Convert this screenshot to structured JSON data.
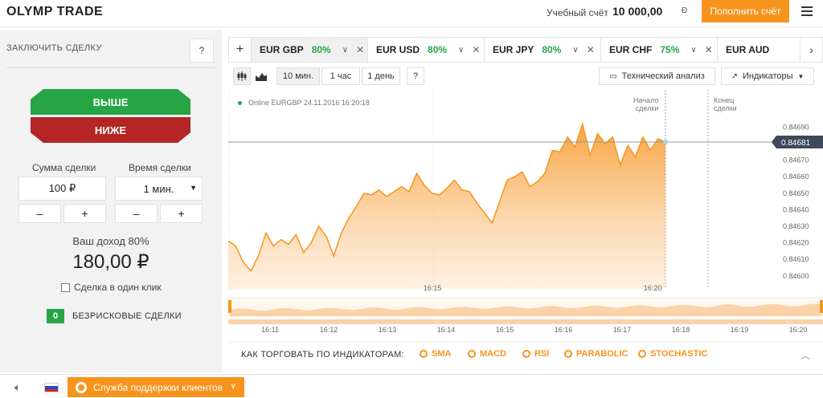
{
  "header": {
    "logo": "OLYMP TRADE",
    "account_label": "Учебный счёт",
    "account_value": "10 000,00",
    "account_currency": "Đ",
    "deposit_label": "Пополнить счёт"
  },
  "left": {
    "title": "ЗАКЛЮЧИТЬ СДЕЛКУ",
    "help": "?",
    "up_label": "ВЫШЕ",
    "down_label": "НИЖЕ",
    "amount_label": "Сумма сделки",
    "amount_value": "100 ₽",
    "time_label": "Время сделки",
    "time_value": "1 мин.",
    "minus": "–",
    "plus": "+",
    "profit_label": "Ваш доход 80%",
    "profit_value": "180,00 ₽",
    "oneclick_label": "Сделка в один клик",
    "riskfree_count": "0",
    "riskfree_label": "БЕЗРИСКОВЫЕ СДЕЛКИ"
  },
  "bottom": {
    "support_label": "Служба поддержки клиентов"
  },
  "tabs": [
    {
      "pair": "EUR GBP",
      "pct": "80%",
      "active": true
    },
    {
      "pair": "EUR USD",
      "pct": "80%",
      "active": false
    },
    {
      "pair": "EUR JPY",
      "pct": "80%",
      "active": false
    },
    {
      "pair": "EUR CHF",
      "pct": "75%",
      "active": false
    },
    {
      "pair": "EUR AUD",
      "pct": "",
      "active": false
    }
  ],
  "toolbar": {
    "tf_10m": "10 мин.",
    "tf_1h": "1 час",
    "tf_1d": "1 день",
    "help": "?",
    "tech_analysis": "Технический анализ",
    "indicators": "Индикаторы"
  },
  "chart": {
    "online_text": "Online EURGBP 24.11.2016 16:20:18",
    "start_label_1": "Начало",
    "start_label_2": "сделки",
    "end_label_1": "Конец",
    "end_label_2": "сделки",
    "current_price": "0.84681",
    "x_ticks": [
      "16:15",
      "16:20"
    ],
    "nav_ticks": [
      "16:11",
      "16:12",
      "16:13",
      "16:14",
      "16:15",
      "16:16",
      "16:17",
      "16:18",
      "16:19",
      "16:20"
    ],
    "accent": "#f7941d"
  },
  "chart_data": {
    "type": "area",
    "title": "",
    "xlabel": "",
    "ylabel": "",
    "ylim": [
      0.84596,
      0.84698
    ],
    "y_ticks": [
      0.8469,
      0.8468,
      0.8467,
      0.8466,
      0.8465,
      0.8464,
      0.8463,
      0.8462,
      0.8461,
      0.846
    ],
    "x_ticks": [
      "16:15",
      "16:20"
    ],
    "series": [
      {
        "values": [
          0.84621,
          0.84618,
          0.84608,
          0.84603,
          0.84612,
          0.84626,
          0.84618,
          0.84622,
          0.84619,
          0.84625,
          0.84614,
          0.8462,
          0.8463,
          0.84624,
          0.84612,
          0.84626,
          0.84635,
          0.84642,
          0.8465,
          0.84649,
          0.84652,
          0.84648,
          0.84651,
          0.84654,
          0.84651,
          0.84662,
          0.84655,
          0.8465,
          0.84649,
          0.84653,
          0.84658,
          0.84652,
          0.84651,
          0.84644,
          0.84638,
          0.84632,
          0.84645,
          0.84658,
          0.8466,
          0.84663,
          0.84654,
          0.84657,
          0.84662,
          0.84676,
          0.84675,
          0.84684,
          0.84678,
          0.84692,
          0.84673,
          0.84686,
          0.8468,
          0.84684,
          0.84667,
          0.84679,
          0.84672,
          0.84684,
          0.84676,
          0.84683,
          0.84681
        ]
      }
    ]
  }
}
